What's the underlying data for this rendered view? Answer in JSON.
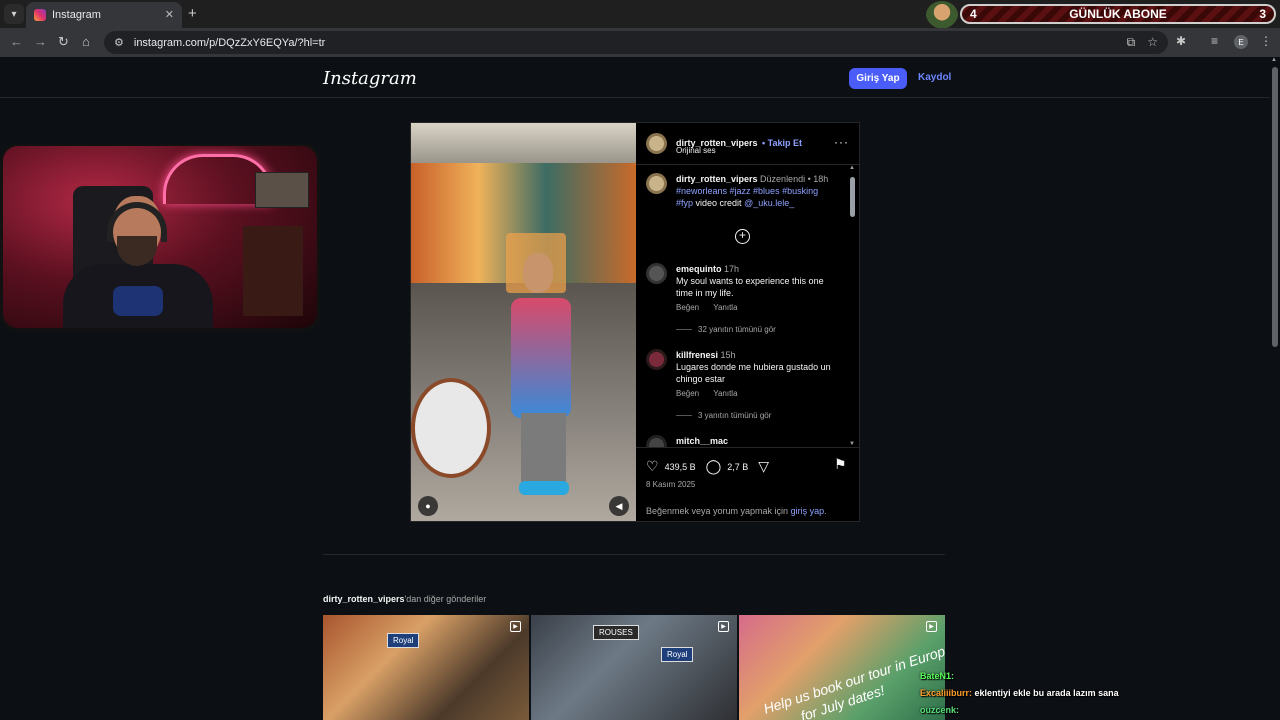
{
  "browser": {
    "tab_title": "Instagram",
    "url": "instagram.com/p/DQzZxY6EQYa/?hl=tr",
    "profile_initial": "E"
  },
  "stream_overlay": {
    "left_count": "4",
    "label": "GÜNLÜK ABONE",
    "right_count": "3"
  },
  "header": {
    "logo": "Instagram",
    "login_label": "Giriş Yap",
    "signup_label": "Kaydol"
  },
  "post": {
    "author": "dirty_rotten_vipers",
    "follow_label": "Takip Et",
    "audio": "Orijinal ses",
    "caption": {
      "username": "dirty_rotten_vipers",
      "edited": "Düzenlendi",
      "time": "18h",
      "hashtags_line1": "#neworleans #jazz #blues #busking",
      "hashtags_line2": "#fyp",
      "credit_text": "video credit",
      "credit_handle": "@_uku.lele_"
    },
    "comments": [
      {
        "username": "emequinto",
        "time": "17h",
        "text": "My soul wants to experience this one time in my life.",
        "like": "Beğen",
        "reply": "Yanıtla",
        "replies": "32 yanıtın tümünü gör"
      },
      {
        "username": "killfrenesi",
        "time": "15h",
        "text": "Lugares donde me hubiera gustado un chingo estar",
        "like": "Beğen",
        "reply": "Yanıtla",
        "replies": "3 yanıtın tümünü gör"
      },
      {
        "username": "mitch__mac"
      }
    ],
    "likes": "439,5 B",
    "comment_count": "2,7 B",
    "date": "8 Kasım 2025",
    "login_prompt": "Beğenmek veya yorum yapmak için",
    "login_link": "giriş yap"
  },
  "more_posts": {
    "username": "dirty_rotten_vipers",
    "suffix": "'dan diğer gönderiler",
    "tiles": [
      {
        "sign": "Royal"
      },
      {
        "sign": "Royal",
        "sign2": "ROUSES"
      },
      {
        "promo": "Help us book our tour in Europe!",
        "promo2": "for July dates!"
      }
    ]
  },
  "chat": [
    {
      "name": "BateN1:",
      "msg": ""
    },
    {
      "name": "Excaliiiburr:",
      "msg": "eklentiyi ekle bu arada lazım sana"
    },
    {
      "name": "ouzcenk:",
      "msg": ""
    }
  ],
  "colors": {
    "background": "#0c1014",
    "accent": "#4a5df9",
    "link": "#8ea1ff"
  }
}
